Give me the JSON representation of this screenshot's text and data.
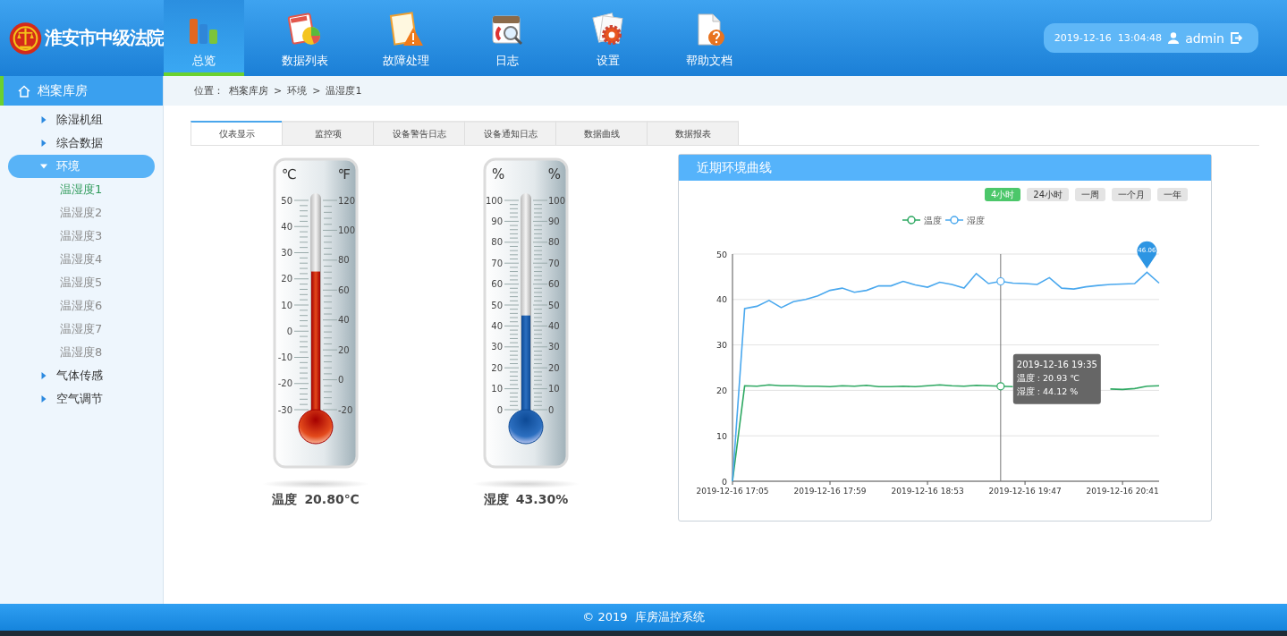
{
  "header": {
    "title": "淮安市中级法院",
    "nav": [
      {
        "label": "总览",
        "kind": "chart",
        "selected": true
      },
      {
        "label": "数据列表",
        "kind": "report",
        "selected": false
      },
      {
        "label": "故障处理",
        "kind": "warning",
        "selected": false
      },
      {
        "label": "日志",
        "kind": "calendar",
        "selected": false
      },
      {
        "label": "设置",
        "kind": "settings",
        "selected": false
      },
      {
        "label": "帮助文档",
        "kind": "help",
        "selected": false
      }
    ],
    "datetime": "2019-12-16  13:04:48",
    "user": "admin"
  },
  "sidebar": {
    "title": "档案库房",
    "items": [
      {
        "label": "除湿机组",
        "expanded": false,
        "selected": false
      },
      {
        "label": "综合数据",
        "expanded": false,
        "selected": false
      },
      {
        "label": "环境",
        "expanded": true,
        "selected": true,
        "children": [
          {
            "label": "温湿度1",
            "selected": true
          },
          {
            "label": "温湿度2",
            "selected": false
          },
          {
            "label": "温湿度3",
            "selected": false
          },
          {
            "label": "温湿度4",
            "selected": false
          },
          {
            "label": "温湿度5",
            "selected": false
          },
          {
            "label": "温湿度6",
            "selected": false
          },
          {
            "label": "温湿度7",
            "selected": false
          },
          {
            "label": "温湿度8",
            "selected": false
          }
        ]
      },
      {
        "label": "气体传感",
        "expanded": false,
        "selected": false
      },
      {
        "label": "空气调节",
        "expanded": false,
        "selected": false
      }
    ]
  },
  "breadcrumb": {
    "label": "位置：",
    "separator": ">",
    "items": [
      "档案库房",
      "环境",
      "温湿度1"
    ]
  },
  "tabs": [
    {
      "label": "仪表显示",
      "selected": true
    },
    {
      "label": "监控项",
      "selected": false
    },
    {
      "label": "设备警告日志",
      "selected": false
    },
    {
      "label": "设备通知日志",
      "selected": false
    },
    {
      "label": "数据曲线",
      "selected": false
    },
    {
      "label": "数据报表",
      "selected": false
    }
  ],
  "gauges": [
    {
      "kind": "temperature",
      "left_unit": "℃",
      "right_unit": "℉",
      "left_scale": [
        "50",
        "40",
        "30",
        "20",
        "10",
        "0",
        "-10",
        "-20",
        "-30"
      ],
      "right_scale": [
        "120",
        "100",
        "80",
        "60",
        "40",
        "20",
        "0",
        "-20"
      ],
      "level": 0.66,
      "label": "温度",
      "value": "20.80℃"
    },
    {
      "kind": "humidity",
      "left_unit": "%",
      "right_unit": "%",
      "left_scale": [
        "100",
        "90",
        "80",
        "70",
        "60",
        "50",
        "40",
        "30",
        "20",
        "10",
        "0"
      ],
      "right_scale": [
        "100",
        "90",
        "80",
        "70",
        "60",
        "50",
        "40",
        "30",
        "20",
        "10",
        "0"
      ],
      "level": 0.45,
      "label": "湿度",
      "value": "43.30%"
    }
  ],
  "chart_panel": {
    "title": "近期环境曲线",
    "ranges": [
      {
        "label": "4小时",
        "selected": true
      },
      {
        "label": "24小时",
        "selected": false
      },
      {
        "label": "一周",
        "selected": false
      },
      {
        "label": "一个月",
        "selected": false
      },
      {
        "label": "一年",
        "selected": false
      }
    ],
    "chart_data": {
      "type": "line",
      "categories": [
        "2019-12-16 17:05",
        null,
        null,
        null,
        null,
        null,
        null,
        null,
        "2019-12-16 17:59",
        null,
        null,
        null,
        null,
        null,
        null,
        null,
        "2019-12-16 18:53",
        null,
        null,
        null,
        null,
        null,
        null,
        null,
        "2019-12-16 19:47",
        null,
        null,
        null,
        null,
        null,
        null,
        null,
        "2019-12-16 20:41",
        null,
        null,
        null
      ],
      "series": [
        {
          "name": "温度",
          "color": "#2ea862",
          "values": [
            0,
            21,
            20.9,
            21.2,
            21,
            21,
            20.9,
            20.9,
            20.8,
            21,
            20.9,
            21.1,
            20.8,
            20.8,
            20.9,
            20.8,
            21,
            21.2,
            21,
            20.9,
            21.1,
            21,
            20.9,
            20.8,
            null,
            null,
            null,
            null,
            null,
            null,
            null,
            20.3,
            20.2,
            20.4,
            20.9,
            21
          ]
        },
        {
          "name": "湿度",
          "color": "#4aa8ee",
          "values": [
            0,
            38,
            38.5,
            39.8,
            38.2,
            39.5,
            40,
            40.8,
            42,
            42.5,
            41.6,
            42,
            43,
            43,
            44,
            43.2,
            42.7,
            43.8,
            43.3,
            42.5,
            45.7,
            43.5,
            44,
            43.6,
            43.5,
            43.3,
            44.8,
            42.5,
            42.3,
            42.8,
            43.1,
            43.3,
            43.4,
            43.5,
            46,
            43.6
          ]
        }
      ],
      "ylim": [
        0,
        50
      ],
      "yticks": [
        0,
        10,
        20,
        30,
        40,
        50
      ],
      "grid": true,
      "legend": "top",
      "annotations": [
        "2019-12-16 19:35\n温度 : 20.93 ℃\n湿度 : 44.12 %",
        "46.06"
      ]
    }
  },
  "footer": "© 2019  库房温控系统"
}
